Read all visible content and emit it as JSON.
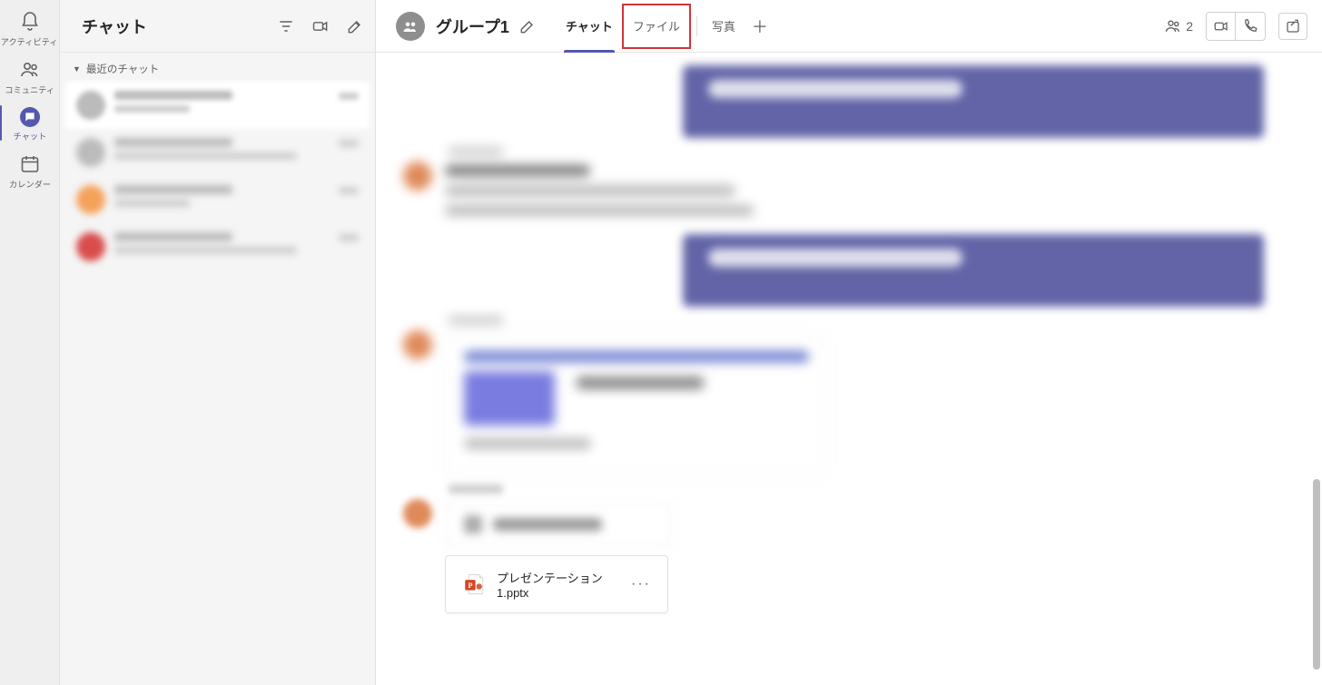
{
  "rail": {
    "activity": "アクティビティ",
    "community": "コミュニティ",
    "chat": "チャット",
    "calendar": "カレンダー"
  },
  "chatPanel": {
    "title": "チャット",
    "recent": "最近のチャット"
  },
  "header": {
    "group_name": "グループ1",
    "tabs": {
      "chat": "チャット",
      "file": "ファイル",
      "photo": "写真"
    },
    "participants_count": "2"
  },
  "file": {
    "name": "プレゼンテーション1.pptx"
  }
}
